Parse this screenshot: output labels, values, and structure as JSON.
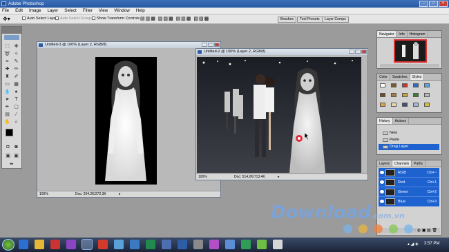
{
  "app": {
    "title": "Adobe Photoshop"
  },
  "menu": [
    "File",
    "Edit",
    "Image",
    "Layer",
    "Select",
    "Filter",
    "View",
    "Window",
    "Help"
  ],
  "options": {
    "auto_select_layer": "Auto Select Layer",
    "auto_select_groups": "Auto Select Groups",
    "show_transform": "Show Transform Controls"
  },
  "palette_well_tabs": [
    "Brushes",
    "Tool Presets",
    "Layer Comps"
  ],
  "doc1": {
    "title": "Untitled-3 @ 100% (Layer 2, RGB/8)",
    "zoom": "100%",
    "doc_info": "Doc: 204.2K/272.3K"
  },
  "doc2": {
    "title": "Untitled-2 @ 100% (Layer 2, RGB/8)",
    "zoom": "100%",
    "doc_info": "Doc: 514.2K/713.4K"
  },
  "navigator": {
    "tabs": [
      "Navigator",
      "Info",
      "Histogram"
    ]
  },
  "color_palette": {
    "tabs": [
      "Color",
      "Swatches",
      "Styles"
    ]
  },
  "history": {
    "tabs": [
      "History",
      "Actions"
    ],
    "items": [
      "New",
      "Paste",
      "Drag Layer"
    ]
  },
  "channels": {
    "tabs": [
      "Layers",
      "Channels",
      "Paths"
    ],
    "rows": [
      {
        "name": "RGB",
        "shortcut": "Ctrl+~"
      },
      {
        "name": "Red",
        "shortcut": "Ctrl+1"
      },
      {
        "name": "Green",
        "shortcut": "Ctrl+2"
      },
      {
        "name": "Blue",
        "shortcut": "Ctrl+3"
      }
    ]
  },
  "watermark": {
    "brand": "Download",
    "tld": ".com.vn"
  },
  "taskbar": {
    "time": "3:57 PM"
  },
  "colors": {
    "selection": "#1e62d0",
    "titlebar": "#2758a5"
  }
}
